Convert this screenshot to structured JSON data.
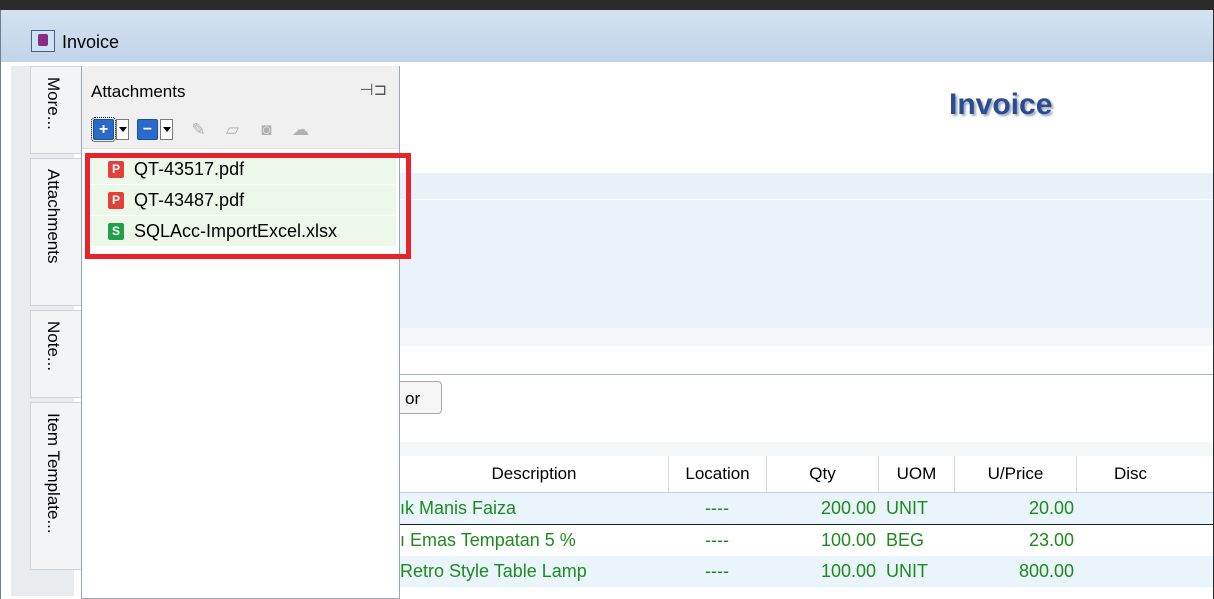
{
  "window": {
    "title": "Invoice"
  },
  "side_tabs": [
    "More...",
    "Attachments",
    "Note...",
    "Item Template..."
  ],
  "attachments": {
    "title": "Attachments",
    "toolbar": {
      "add": "+",
      "remove": "−"
    },
    "files": [
      {
        "name": "QT-43517.pdf",
        "type": "pdf"
      },
      {
        "name": "QT-43487.pdf",
        "type": "pdf"
      },
      {
        "name": "SQLAcc-ImportExcel.xlsx",
        "type": "xlsx"
      }
    ]
  },
  "form": {
    "title": "Invoice",
    "partial_button": "or",
    "grid": {
      "columns": [
        "Description",
        "Location",
        "Qty",
        "UOM",
        "U/Price",
        "Disc"
      ],
      "rows": [
        {
          "description": "ık Manis Faiza",
          "location": "----",
          "qty": "200.00",
          "uom": "UNIT",
          "price": "20.00",
          "disc": ""
        },
        {
          "description": "ı Emas Tempatan 5 %",
          "location": "----",
          "qty": "100.00",
          "uom": "BEG",
          "price": "23.00",
          "disc": ""
        },
        {
          "description": "Retro Style Table Lamp",
          "location": "----",
          "qty": "100.00",
          "uom": "UNIT",
          "price": "800.00",
          "disc": ""
        }
      ]
    }
  },
  "colors": {
    "highlight_border": "#e8232c",
    "form_title": "#2d4c8f",
    "row_text": "#1e8a1e"
  }
}
